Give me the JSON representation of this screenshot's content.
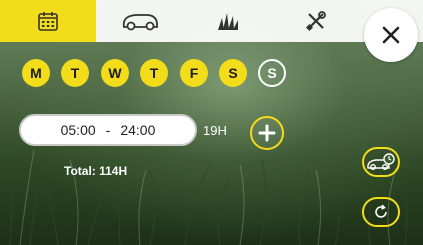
{
  "tabs": [
    {
      "name": "calendar-icon",
      "active": true
    },
    {
      "name": "mower-icon",
      "active": false
    },
    {
      "name": "grass-icon",
      "active": false
    },
    {
      "name": "tools-icon",
      "active": false
    }
  ],
  "close_icon": "close-icon",
  "days": [
    {
      "label": "M",
      "selected": true
    },
    {
      "label": "T",
      "selected": true
    },
    {
      "label": "W",
      "selected": true
    },
    {
      "label": "T",
      "selected": true
    },
    {
      "label": "F",
      "selected": true
    },
    {
      "label": "S",
      "selected": true
    },
    {
      "label": "S",
      "selected": false
    }
  ],
  "schedule": {
    "start": "05:00",
    "separator": "-",
    "end": "24:00",
    "duration": "19H"
  },
  "total_label": "Total: 114H",
  "colors": {
    "accent": "#f3dc1a",
    "topbar": "#ffffff"
  }
}
